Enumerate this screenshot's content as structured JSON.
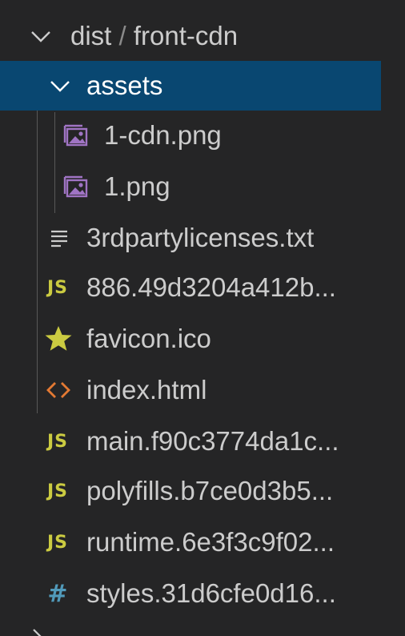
{
  "root": {
    "path_parent": "dist",
    "separator": "/",
    "path_child": "front-cdn"
  },
  "folder": {
    "name": "assets",
    "children": [
      "1-cdn.png",
      "1.png"
    ]
  },
  "files": [
    {
      "name": "3rdpartylicenses.txt",
      "icon": "text-lines-icon"
    },
    {
      "name": "886.49d3204a412b...",
      "icon": "js-icon",
      "icon_text": "JS"
    },
    {
      "name": "favicon.ico",
      "icon": "star-icon"
    },
    {
      "name": "index.html",
      "icon": "code-brackets-icon"
    },
    {
      "name": "main.f90c3774da1c...",
      "icon": "js-icon",
      "icon_text": "JS"
    },
    {
      "name": "polyfills.b7ce0d3b5...",
      "icon": "js-icon",
      "icon_text": "JS"
    },
    {
      "name": "runtime.6e3f3c9f02...",
      "icon": "js-icon",
      "icon_text": "JS"
    },
    {
      "name": "styles.31d6cfe0d16...",
      "icon": "hash-icon",
      "icon_text": "#"
    }
  ],
  "colors": {
    "background": "#252526",
    "selected": "#094771",
    "text": "#cccccc",
    "js": "#cbcb41",
    "image": "#a074c4",
    "html": "#e37933",
    "css": "#519aba",
    "star": "#cbcb41"
  }
}
